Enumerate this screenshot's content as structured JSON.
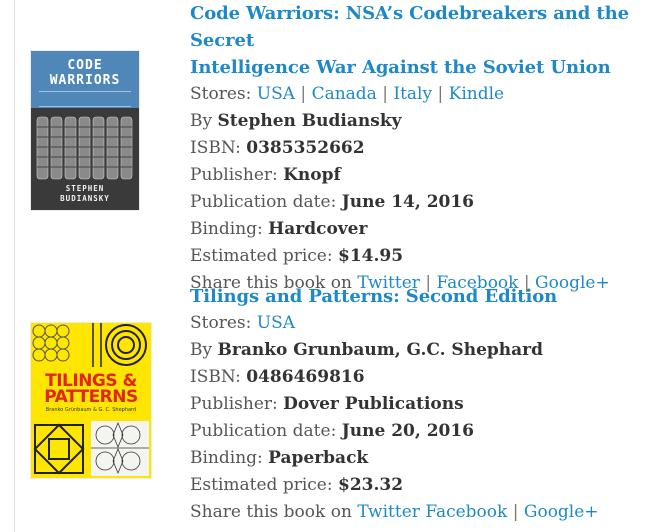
{
  "labels": {
    "stores": "Stores:",
    "by": "By",
    "isbn": "ISBN:",
    "publisher": "Publisher:",
    "publication_date": "Publication date:",
    "binding": "Binding:",
    "estimated_price": "Estimated price:",
    "share": "Share this book on",
    "separator": "|"
  },
  "books": [
    {
      "title": "Code Warriors: NSA's Codebreakers and the Secret Intelligence War Against the Soviet Union",
      "title_line1": "Code Warriors: NSA’s Codebreakers and the Secret",
      "title_line2": "Intelligence War Against the Soviet Union",
      "stores": [
        "USA",
        "Canada",
        "Italy",
        "Kindle"
      ],
      "author": "Stephen Budiansky",
      "isbn": "0385352662",
      "publisher": "Knopf",
      "publication_date": "June 14, 2016",
      "binding": "Hardcover",
      "price": "$14.95",
      "share": [
        "Twitter",
        "Facebook",
        "Google+"
      ],
      "cover": {
        "title_line1": "CODE",
        "title_line2": "WARRIORS",
        "author_line1": "STEPHEN",
        "author_line2": "BUDIANSKY"
      }
    },
    {
      "title": "Tilings and Patterns: Second Edition",
      "stores": [
        "USA"
      ],
      "author": "Branko Grunbaum, G.C. Shephard",
      "isbn": "0486469816",
      "publisher": "Dover Publications",
      "publication_date": "June 20, 2016",
      "binding": "Paperback",
      "price": "$23.32",
      "share": [
        "Twitter",
        "Facebook",
        "Google+"
      ],
      "cover": {
        "title_line1": "TILINGS &",
        "title_line2": "PATTERNS",
        "authors": "Branko Grünbaum & G. C. Shephard"
      }
    }
  ],
  "colors": {
    "link": "#1e88c8",
    "text": "#555555",
    "value": "#333333",
    "cw_cover_blue": "#4f87b8",
    "tp_cover_yellow": "#ffe600",
    "tp_title_red": "#e0261e"
  }
}
